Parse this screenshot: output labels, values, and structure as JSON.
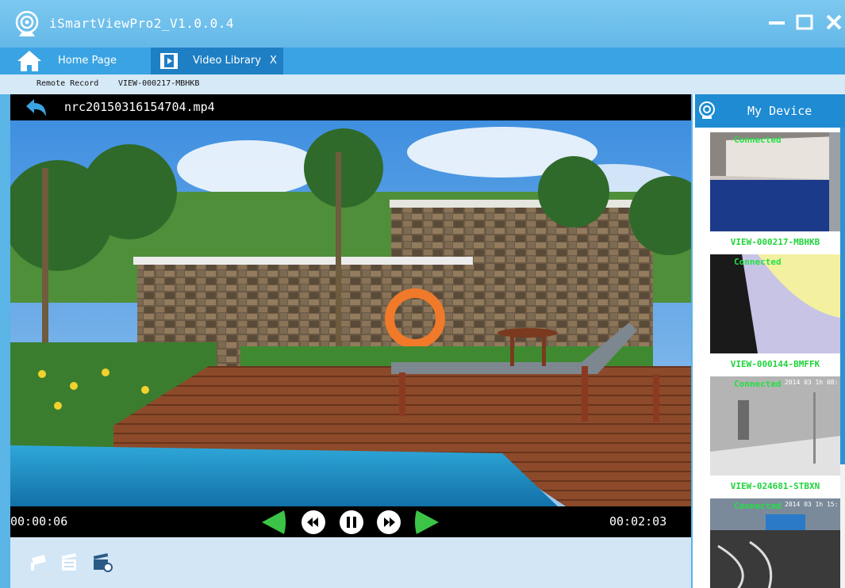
{
  "app": {
    "title": "iSmartViewPro2_V1.0.0.4"
  },
  "tabs": {
    "home_label": "Home Page",
    "video_label": "Video Library",
    "video_close": "X"
  },
  "breadcrumb": {
    "section": "Remote Record",
    "device": "VIEW-000217-MBHKB"
  },
  "player": {
    "filename": "nrc20150316154704.mp4",
    "current_time": "00:00:06",
    "total_time": "00:02:03"
  },
  "sidebar": {
    "title": "My Device",
    "devices": [
      {
        "status": "Connected",
        "name": "VIEW-000217-MBHKB",
        "timestamp": ""
      },
      {
        "status": "Connected",
        "name": "VIEW-000144-BMFFK",
        "timestamp": ""
      },
      {
        "status": "Connected",
        "name": "VIEW-024681-STBXN",
        "timestamp": "2014 03 1h 08:"
      },
      {
        "status": "Connected",
        "name": "",
        "timestamp": "2014 03 1h 15:"
      }
    ]
  },
  "colors": {
    "accent": "#3aa3e3",
    "title_bar": "#6abdea",
    "status_green": "#23e043",
    "play_green": "#3cc447"
  },
  "icons": [
    "app-logo-icon",
    "home-icon",
    "film-icon",
    "back-icon",
    "prev-icon",
    "rewind-icon",
    "pause-icon",
    "forward-icon",
    "next-icon",
    "camera-icon",
    "record-list-icon",
    "video-settings-icon",
    "device-camera-icon",
    "minimize-icon",
    "maximize-icon",
    "close-icon"
  ]
}
